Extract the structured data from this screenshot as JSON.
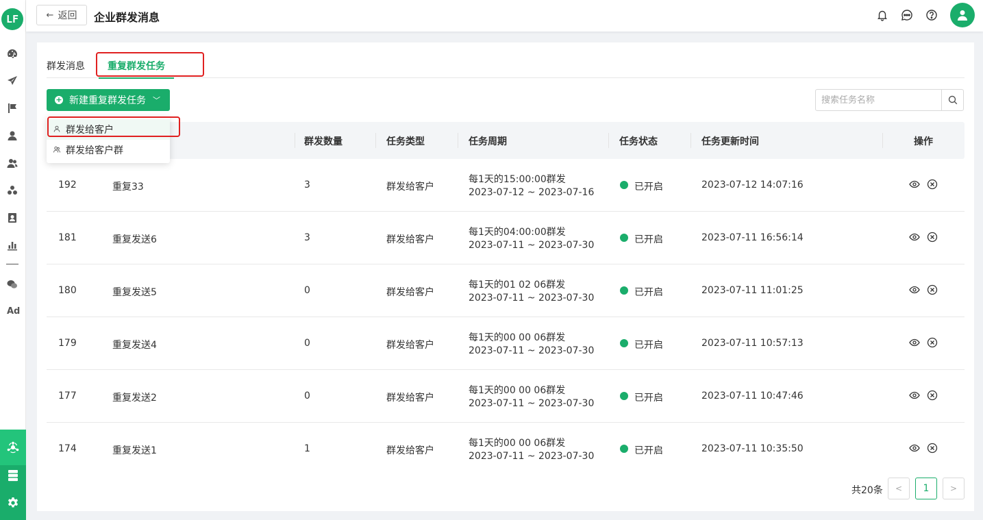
{
  "app": {
    "logo_text": "LF"
  },
  "header": {
    "back_label": "返回",
    "title": "企业群发消息"
  },
  "sidebar": {
    "ad_label": "Ad",
    "icons": [
      "dashboard-icon",
      "send-icon",
      "flag-icon",
      "user-icon",
      "users-icon",
      "group-icon",
      "contacts-icon",
      "bar-chart-icon",
      "wechat-icon"
    ],
    "bottom_icons": [
      "connect-icon",
      "server-icon",
      "settings-icon"
    ]
  },
  "tabs": [
    {
      "label": "群发消息"
    },
    {
      "label": "重复群发任务"
    }
  ],
  "toolbar": {
    "new_button_label": "新建重复群发任务",
    "search_placeholder": "搜索任务名称"
  },
  "dropdown": {
    "items": [
      {
        "label": "群发给客户"
      },
      {
        "label": "群发给客户群"
      }
    ]
  },
  "table": {
    "headers": [
      "群发数量",
      "任务类型",
      "任务周期",
      "任务状态",
      "任务更新时间",
      "操作"
    ],
    "rows": [
      {
        "id": "192",
        "name": "重复33",
        "count": "3",
        "type": "群发给客户",
        "cycle": "每1天的15:00:00群发",
        "range": "2023-07-12 ~ 2023-07-16",
        "status": "已开启",
        "updated": "2023-07-12 14:07:16"
      },
      {
        "id": "181",
        "name": "重复发送6",
        "count": "3",
        "type": "群发给客户",
        "cycle": "每1天的04:00:00群发",
        "range": "2023-07-11 ~ 2023-07-30",
        "status": "已开启",
        "updated": "2023-07-11 16:56:14"
      },
      {
        "id": "180",
        "name": "重复发送5",
        "count": "0",
        "type": "群发给客户",
        "cycle": "每1天的01 02 06群发",
        "range": "2023-07-11 ~ 2023-07-30",
        "status": "已开启",
        "updated": "2023-07-11 11:01:25"
      },
      {
        "id": "179",
        "name": "重复发送4",
        "count": "0",
        "type": "群发给客户",
        "cycle": "每1天的00 00 06群发",
        "range": "2023-07-11 ~ 2023-07-30",
        "status": "已开启",
        "updated": "2023-07-11 10:57:13"
      },
      {
        "id": "177",
        "name": "重复发送2",
        "count": "0",
        "type": "群发给客户",
        "cycle": "每1天的00 00 06群发",
        "range": "2023-07-11 ~ 2023-07-30",
        "status": "已开启",
        "updated": "2023-07-11 10:47:46"
      },
      {
        "id": "174",
        "name": "重复发送1",
        "count": "1",
        "type": "群发给客户",
        "cycle": "每1天的00 00 06群发",
        "range": "2023-07-11 ~ 2023-07-30",
        "status": "已开启",
        "updated": "2023-07-11 10:35:50"
      }
    ]
  },
  "pagination": {
    "total_label": "共20条",
    "current_page": "1",
    "prev_label": "<",
    "next_label": ">"
  },
  "colors": {
    "accent": "#1aad6b",
    "highlight_box": "#e02020"
  }
}
